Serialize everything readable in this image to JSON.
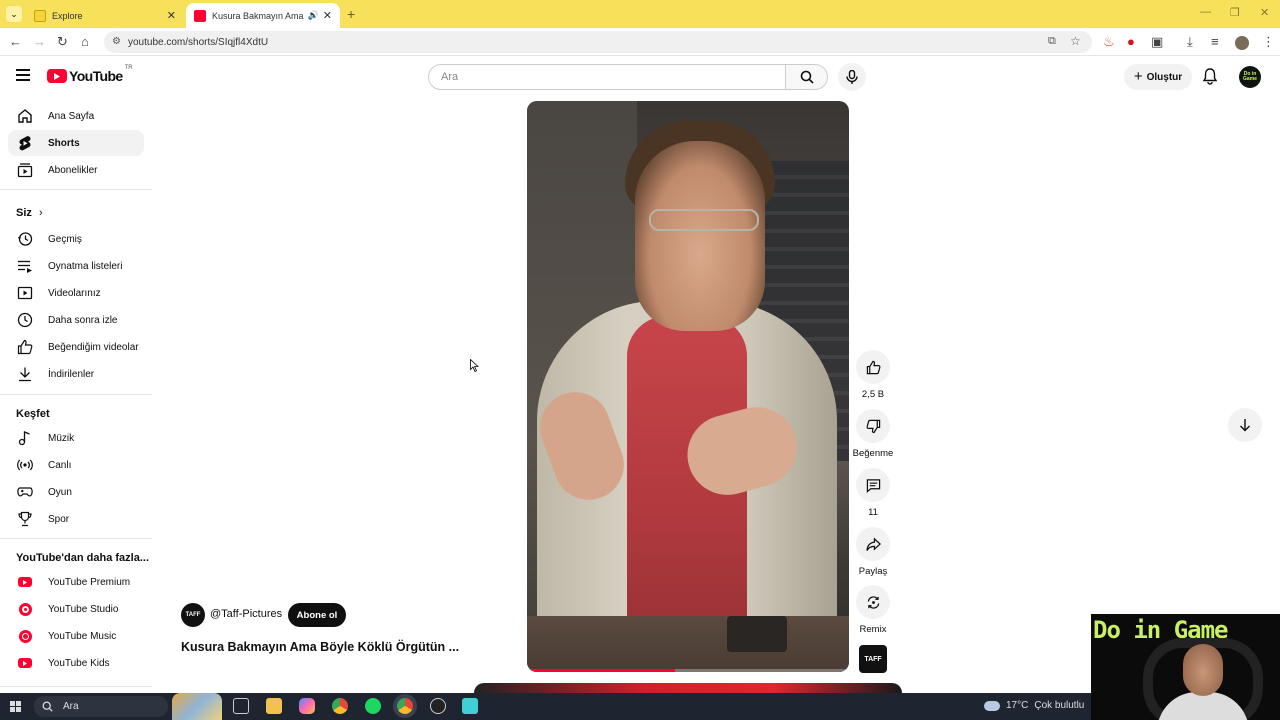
{
  "browser": {
    "tabs": [
      {
        "label": "Explore",
        "active": false
      },
      {
        "label": "Kusura Bakmayın Ama Böyle",
        "active": true
      }
    ],
    "url": "youtube.com/shorts/SIqjfl4XdtU"
  },
  "masthead": {
    "logo_text": "YouTube",
    "region": "TR",
    "search_placeholder": "Ara",
    "create_label": "Oluştur"
  },
  "sidebar": {
    "main": [
      {
        "label": "Ana Sayfa",
        "icon": "home-icon"
      },
      {
        "label": "Shorts",
        "icon": "shorts-icon",
        "active": true
      },
      {
        "label": "Abonelikler",
        "icon": "subscriptions-icon"
      }
    ],
    "you_heading": "Siz",
    "you": [
      {
        "label": "Geçmiş",
        "icon": "history-icon"
      },
      {
        "label": "Oynatma listeleri",
        "icon": "playlists-icon"
      },
      {
        "label": "Videolarınız",
        "icon": "your-videos-icon"
      },
      {
        "label": "Daha sonra izle",
        "icon": "watch-later-icon"
      },
      {
        "label": "Beğendiğim videolar",
        "icon": "liked-icon"
      },
      {
        "label": "İndirilenler",
        "icon": "download-icon"
      }
    ],
    "explore_heading": "Keşfet",
    "explore": [
      {
        "label": "Müzik",
        "icon": "music-icon"
      },
      {
        "label": "Canlı",
        "icon": "live-icon"
      },
      {
        "label": "Oyun",
        "icon": "gaming-icon"
      },
      {
        "label": "Spor",
        "icon": "trophy-icon"
      }
    ],
    "more_heading": "YouTube'dan daha fazla...",
    "more": [
      {
        "label": "YouTube Premium",
        "icon": "yt-premium-icon"
      },
      {
        "label": "YouTube Studio",
        "icon": "yt-studio-icon"
      },
      {
        "label": "YouTube Music",
        "icon": "yt-music-icon"
      },
      {
        "label": "YouTube Kids",
        "icon": "yt-kids-icon"
      }
    ]
  },
  "short": {
    "channel_handle": "@Taff-Pictures",
    "channel_avatar_text": "TAFF",
    "subscribe_label": "Abone ol",
    "title": "Kusura Bakmayın Ama Böyle Köklü Örgütün ...",
    "progress": 0.46,
    "actions": {
      "likes": "2,5 B",
      "dislike_label": "Beğenme",
      "comments": "11",
      "share_label": "Paylaş",
      "remix_label": "Remix"
    }
  },
  "taskbar": {
    "search_placeholder": "Ara",
    "temperature": "17°C",
    "weather": "Çok bulutlu"
  },
  "webcam": {
    "overlay_text": "Do in Game",
    "avatar_text": "Do in Game"
  },
  "colors": {
    "youtube_red": "#ff0033",
    "chrome_tabbar": "#f7e05a",
    "subscribe_bg": "#0f0f0f"
  }
}
